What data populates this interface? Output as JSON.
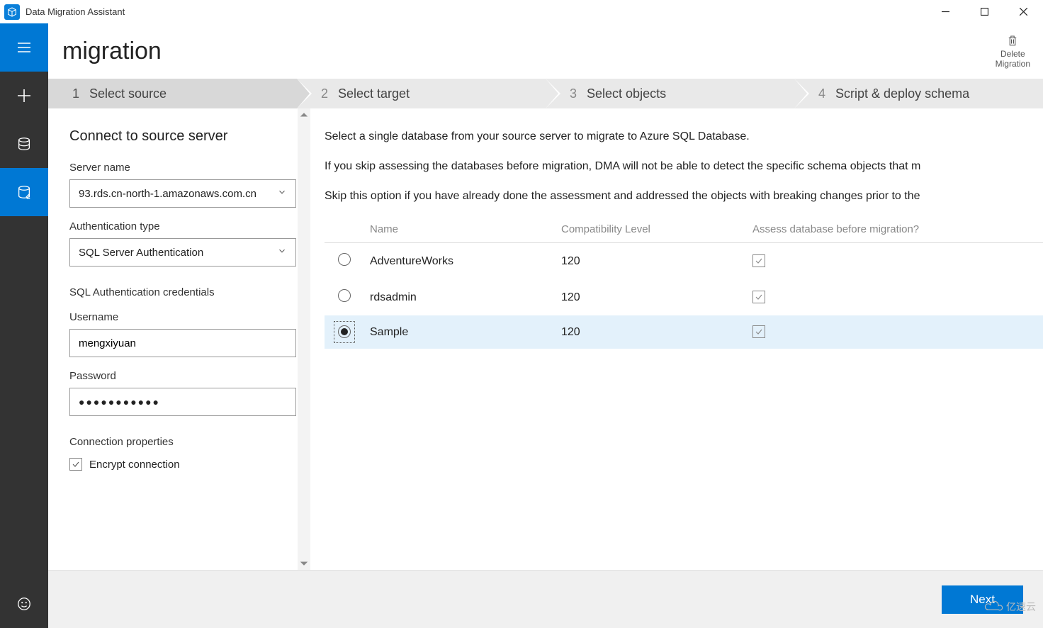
{
  "app": {
    "title": "Data Migration Assistant"
  },
  "header": {
    "page_title": "migration",
    "delete_label_line1": "Delete",
    "delete_label_line2": "Migration"
  },
  "stepper": {
    "steps": [
      {
        "num": "1",
        "label": "Select source",
        "active": true
      },
      {
        "num": "2",
        "label": "Select target",
        "active": false
      },
      {
        "num": "3",
        "label": "Select objects",
        "active": false
      },
      {
        "num": "4",
        "label": "Script & deploy schema",
        "active": false
      }
    ]
  },
  "source_form": {
    "title": "Connect to source server",
    "server_name_label": "Server name",
    "server_name_value": "93.rds.cn-north-1.amazonaws.com.cn",
    "auth_type_label": "Authentication type",
    "auth_type_value": "SQL Server Authentication",
    "credentials_label": "SQL Authentication credentials",
    "username_label": "Username",
    "username_value": "mengxiyuan",
    "password_label": "Password",
    "password_masked": "●●●●●●●●●●●",
    "conn_props_label": "Connection properties",
    "encrypt_label": "Encrypt connection",
    "encrypt_checked": true
  },
  "db_panel": {
    "instruction_line_1": "Select a single database from your source server to migrate to Azure SQL Database.",
    "instruction_line_2": "If you skip assessing the databases before migration, DMA will not be able to detect the specific schema objects that m",
    "instruction_line_3": "Skip this option if you have already done the assessment and addressed the objects with breaking changes prior to the",
    "columns": {
      "name": "Name",
      "compat": "Compatibility Level",
      "assess": "Assess database before migration?"
    },
    "rows": [
      {
        "name": "AdventureWorks",
        "compat": "120",
        "selected": false,
        "assess": true
      },
      {
        "name": "rdsadmin",
        "compat": "120",
        "selected": false,
        "assess": true
      },
      {
        "name": "Sample",
        "compat": "120",
        "selected": true,
        "assess": true
      }
    ]
  },
  "footer": {
    "next_label": "Next"
  },
  "watermark": {
    "text": "亿速云"
  }
}
